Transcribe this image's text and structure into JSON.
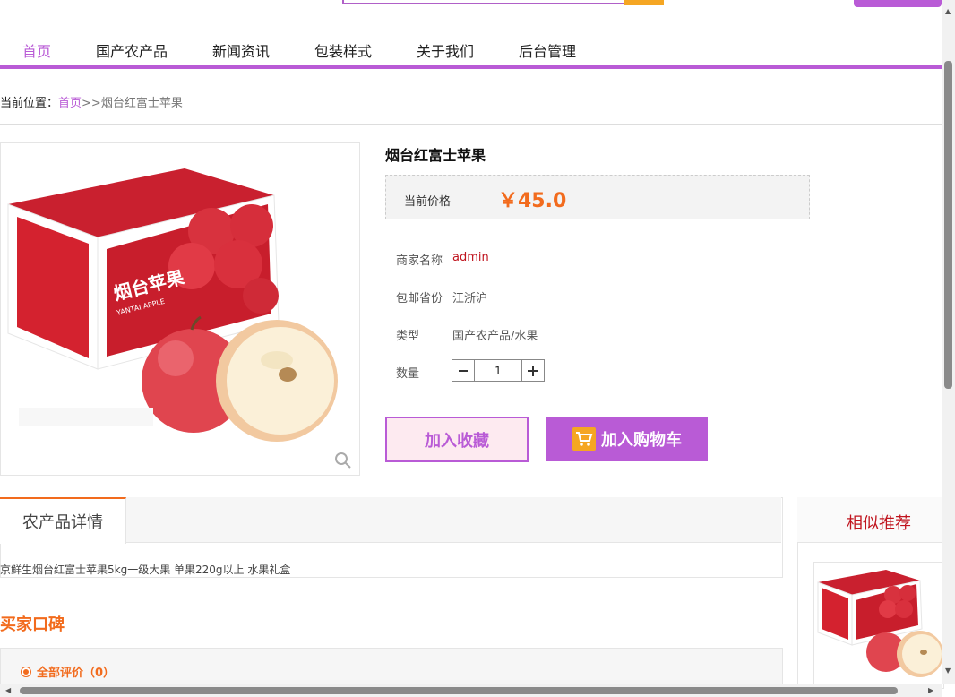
{
  "nav": {
    "items": [
      "首页",
      "国产农产品",
      "新闻资讯",
      "包装样式",
      "关于我们",
      "后台管理"
    ]
  },
  "breadcrumb": {
    "prefix": "当前位置：",
    "home": "首页",
    "separator": ">>",
    "current": "烟台红富士苹果"
  },
  "product": {
    "title": "烟台红富士苹果",
    "price_label": "当前价格",
    "price": "￥45.0",
    "merchant_label": "商家名称",
    "merchant": "admin",
    "shipping_label": "包邮省份",
    "shipping": "江浙沪",
    "type_label": "类型",
    "type": "国产农产品/水果",
    "qty_label": "数量",
    "qty": "1",
    "fav_button": "加入收藏",
    "cart_button": "加入购物车",
    "image_box_texts": [
      "烟台苹果",
      "YANTAI APPLE"
    ]
  },
  "details": {
    "tab": "农产品详情",
    "text": "京鲜生烟台红富士苹果5kg一级大果 单果220g以上 水果礼盒"
  },
  "reviews": {
    "title": "买家口碑",
    "all": "全部评价（0）"
  },
  "similar": {
    "title": "相似推荐"
  },
  "colors": {
    "accent": "#b95bd6",
    "price": "#f26b1d",
    "merchant": "#c0141e"
  }
}
